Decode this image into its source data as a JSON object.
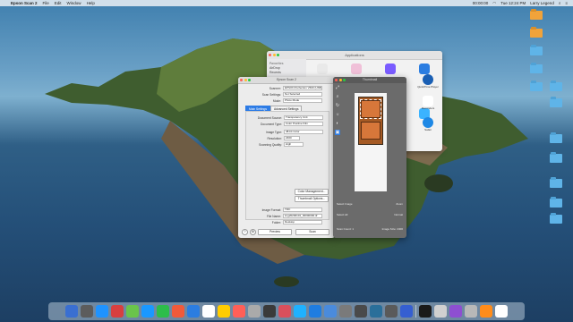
{
  "menubar": {
    "app_name": "Epson Scan 2",
    "items": [
      "File",
      "Edit",
      "Window",
      "Help"
    ],
    "time": "Tue 12:24 PM",
    "user": "Larry Legend",
    "clock_small": "00:00:00"
  },
  "finder": {
    "title": "Applications",
    "sidebar": [
      "Favorites",
      "AirDrop",
      "Recents"
    ],
    "apps": [
      {
        "color": "#e9e9e9"
      },
      {
        "color": "#f0c0d8"
      },
      {
        "color": "#7a5cff"
      },
      {
        "color": "#2b7de1"
      },
      {
        "color": "#f5f5f5"
      },
      {
        "color": "#f8d24a"
      },
      {
        "color": "#ff5a5a"
      },
      {
        "color": "#3bb3ff"
      }
    ],
    "app_labels": [
      "QuickTime Player",
      "Reminders",
      "Safari"
    ]
  },
  "scan": {
    "title": "Epson Scan 2",
    "fields": [
      {
        "label": "Scanner:",
        "value": "EPSON Perfection V600 (USB)"
      },
      {
        "label": "Scan Settings:",
        "value": "Not Selected"
      },
      {
        "label": "Mode:",
        "value": "Photo Mode"
      }
    ],
    "tabs": [
      "Main Settings",
      "Advanced Settings"
    ],
    "main_fields": [
      {
        "label": "Document Source:",
        "value": "Transparency Unit"
      },
      {
        "label": "Document Type:",
        "value": "Color Positive Film"
      },
      {
        "label": "Image Type:",
        "value": "48-bit Color"
      },
      {
        "label": "Resolution:",
        "value": "2400"
      },
      {
        "label": "Scanning Quality:",
        "value": "High"
      }
    ],
    "buttons": [
      "Color Management...",
      "Thumbnail Options..."
    ],
    "bottom_fields": [
      {
        "label": "Image Format:",
        "value": "TIFF"
      },
      {
        "label": "File Name:",
        "value": "img20200101_00000000.tif"
      },
      {
        "label": "Folder:",
        "value": "Desktop"
      }
    ],
    "preview_label": "Preview",
    "scan_label": "Scan"
  },
  "thumbnail": {
    "title": "Thumbnail",
    "controls": [
      "Select Image",
      "Zoom",
      "Select All",
      "Normal",
      "Scan Count: 1",
      "Image Size: 2400"
    ]
  },
  "desktop_icons": [
    {
      "label": "",
      "color": "orange"
    },
    {
      "label": "",
      "color": "orange"
    },
    {
      "label": "",
      "color": "blue"
    },
    {
      "label": "",
      "color": "blue"
    },
    {
      "label": "",
      "color": "blue"
    },
    {
      "label": "",
      "color": "blue"
    },
    {
      "label": "",
      "color": "blue"
    },
    {
      "label": "",
      "color": "blue"
    },
    {
      "label": "",
      "color": "blue"
    },
    {
      "label": "",
      "color": "blue"
    },
    {
      "label": "",
      "color": "blue"
    },
    {
      "label": "",
      "color": "blue"
    }
  ],
  "dock": {
    "apps": [
      "#3a6fd1",
      "#5c5c5c",
      "#1f93ff",
      "#d83f3f",
      "#6ac44a",
      "#1a98ff",
      "#2dbd4a",
      "#f15a3a",
      "#2b7de1",
      "#ffffff",
      "#ffcc00",
      "#ff5f57",
      "#aaa",
      "#3a3a3a",
      "#d94f5c",
      "#1fb1ff",
      "#1f7de1",
      "#4a8bdc",
      "#7a7a7a",
      "#4a4a4a",
      "#2a6f9a",
      "#5a5a5a",
      "#355fd1",
      "#1a1a1a",
      "#d0d0d0",
      "#8e4fd1",
      "#b8b8b8",
      "#ff8c1a",
      "#ffffff"
    ]
  }
}
